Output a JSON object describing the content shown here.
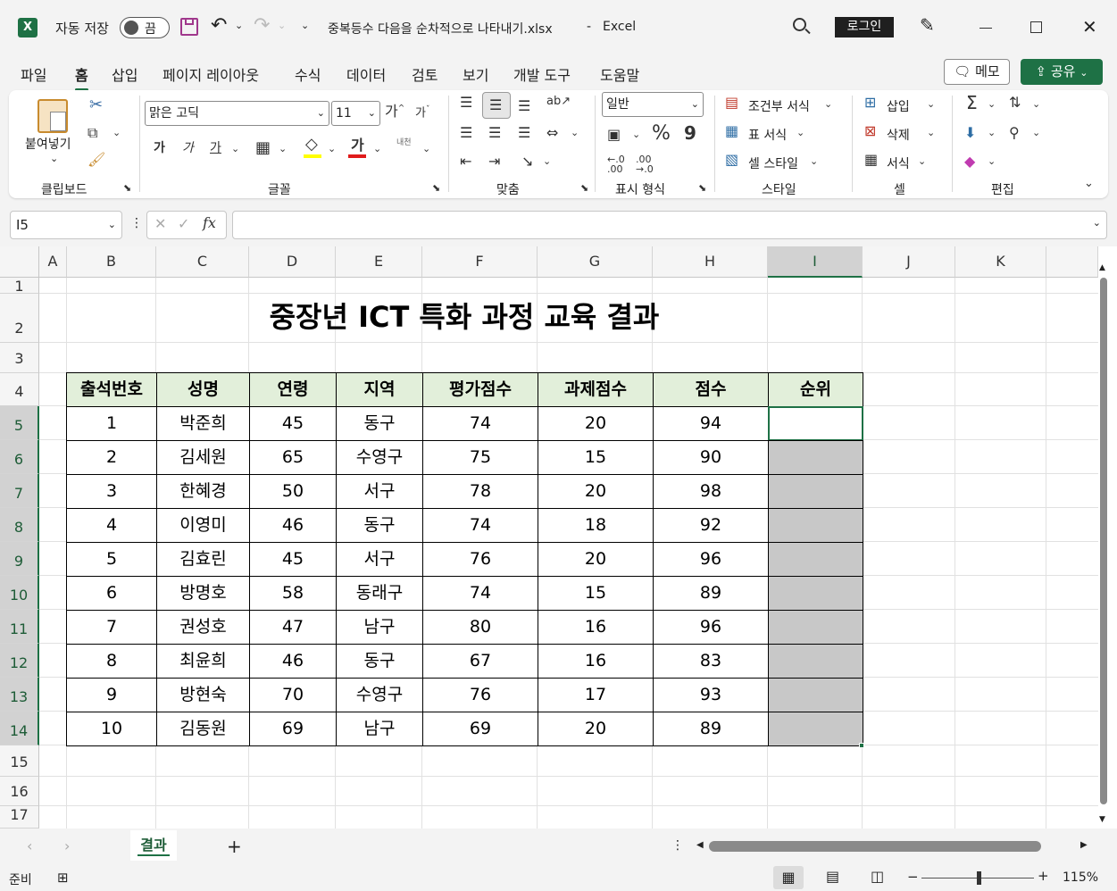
{
  "titlebar": {
    "autosave_label": "자동 저장",
    "autosave_state": "끔",
    "filename": "중복등수 다음을 순차적으로 나타내기.xlsx",
    "separator": "-",
    "app_name": "Excel",
    "login_label": "로그인"
  },
  "menu": {
    "items": [
      "파일",
      "홈",
      "삽입",
      "페이지 레이아웃",
      "수식",
      "데이터",
      "검토",
      "보기",
      "개발 도구",
      "도움말"
    ],
    "memo_label": "메모",
    "share_label": "공유"
  },
  "ribbon": {
    "clipboard": {
      "paste_label": "붙여넣기",
      "group_label": "클립보드"
    },
    "font": {
      "font_name": "맑은 고딕",
      "font_size": "11",
      "group_label": "글꼴",
      "bold": "가",
      "italic": "가",
      "underline": "가",
      "font_color_glyph": "가",
      "phonetic": "내천"
    },
    "alignment": {
      "group_label": "맞춤"
    },
    "number": {
      "format": "일반",
      "group_label": "표시 형식",
      "percent": "%",
      "comma": "9"
    },
    "styles": {
      "conditional": "조건부 서식",
      "as_table": "표 서식",
      "cell_styles": "셀 스타일",
      "group_label": "스타일"
    },
    "cells": {
      "insert": "삽입",
      "delete": "삭제",
      "format": "서식",
      "group_label": "셀"
    },
    "editing": {
      "group_label": "편집"
    }
  },
  "formula_bar": {
    "name_box": "I5",
    "fx": "fx",
    "formula": ""
  },
  "sheet": {
    "columns": [
      "A",
      "B",
      "C",
      "D",
      "E",
      "F",
      "G",
      "H",
      "I",
      "J",
      "K"
    ],
    "selected_column": "I",
    "rows": [
      "1",
      "2",
      "3",
      "4",
      "5",
      "6",
      "7",
      "8",
      "9",
      "10",
      "11",
      "12",
      "13",
      "14",
      "15",
      "16",
      "17"
    ],
    "title": "중장년 ICT 특화 과정 교육 결과",
    "headers": [
      "출석번호",
      "성명",
      "연령",
      "지역",
      "평가점수",
      "과제점수",
      "점수",
      "순위"
    ],
    "data": [
      [
        "1",
        "박준희",
        "45",
        "동구",
        "74",
        "20",
        "94",
        ""
      ],
      [
        "2",
        "김세원",
        "65",
        "수영구",
        "75",
        "15",
        "90",
        ""
      ],
      [
        "3",
        "한혜경",
        "50",
        "서구",
        "78",
        "20",
        "98",
        ""
      ],
      [
        "4",
        "이영미",
        "46",
        "동구",
        "74",
        "18",
        "92",
        ""
      ],
      [
        "5",
        "김효린",
        "45",
        "서구",
        "76",
        "20",
        "96",
        ""
      ],
      [
        "6",
        "방명호",
        "58",
        "동래구",
        "74",
        "15",
        "89",
        ""
      ],
      [
        "7",
        "권성호",
        "47",
        "남구",
        "80",
        "16",
        "96",
        ""
      ],
      [
        "8",
        "최윤희",
        "46",
        "동구",
        "67",
        "16",
        "83",
        ""
      ],
      [
        "9",
        "방현숙",
        "70",
        "수영구",
        "76",
        "17",
        "93",
        ""
      ],
      [
        "10",
        "김동원",
        "69",
        "남구",
        "69",
        "20",
        "89",
        ""
      ]
    ]
  },
  "sheet_tabs": {
    "active": "결과",
    "add": "+"
  },
  "status": {
    "ready": "준비",
    "zoom": "115%",
    "minus": "−",
    "plus": "+"
  },
  "colors": {
    "accent": "#1e7145",
    "header_fill": "#e2efda",
    "rank_fill": "#c8c8c8"
  }
}
